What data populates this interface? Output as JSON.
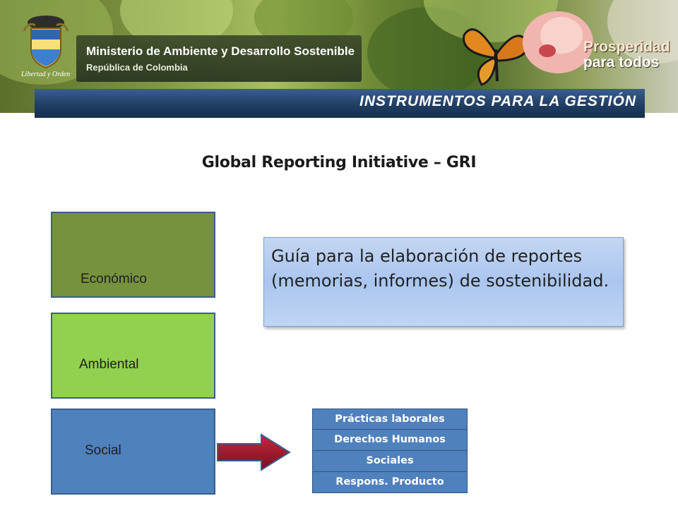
{
  "header": {
    "ministry_name": "Ministerio de Ambiente y Desarrollo Sostenible",
    "ministry_subtitle": "República de Colombia",
    "crest_motto": "Libertad y Orden",
    "slogan_line1": "Prosperidad",
    "slogan_line2": "para todos",
    "section_title": "INSTRUMENTOS PARA LA GESTIÓN"
  },
  "main": {
    "title": "Global Reporting Initiative – GRI",
    "dimensions": [
      {
        "label": "Económico",
        "color": "#76923c"
      },
      {
        "label": "Ambiental",
        "color": "#92d050"
      },
      {
        "label": "Social",
        "color": "#4f81bd"
      }
    ],
    "guide_text": "Guía para la elaboración de reportes (memorias, informes) de sostenibilidad.",
    "social_subcategories": [
      "Prácticas laborales",
      "Derechos Humanos",
      "Sociales",
      "Respons. Producto"
    ],
    "arrow_color": "#a01d2c"
  }
}
